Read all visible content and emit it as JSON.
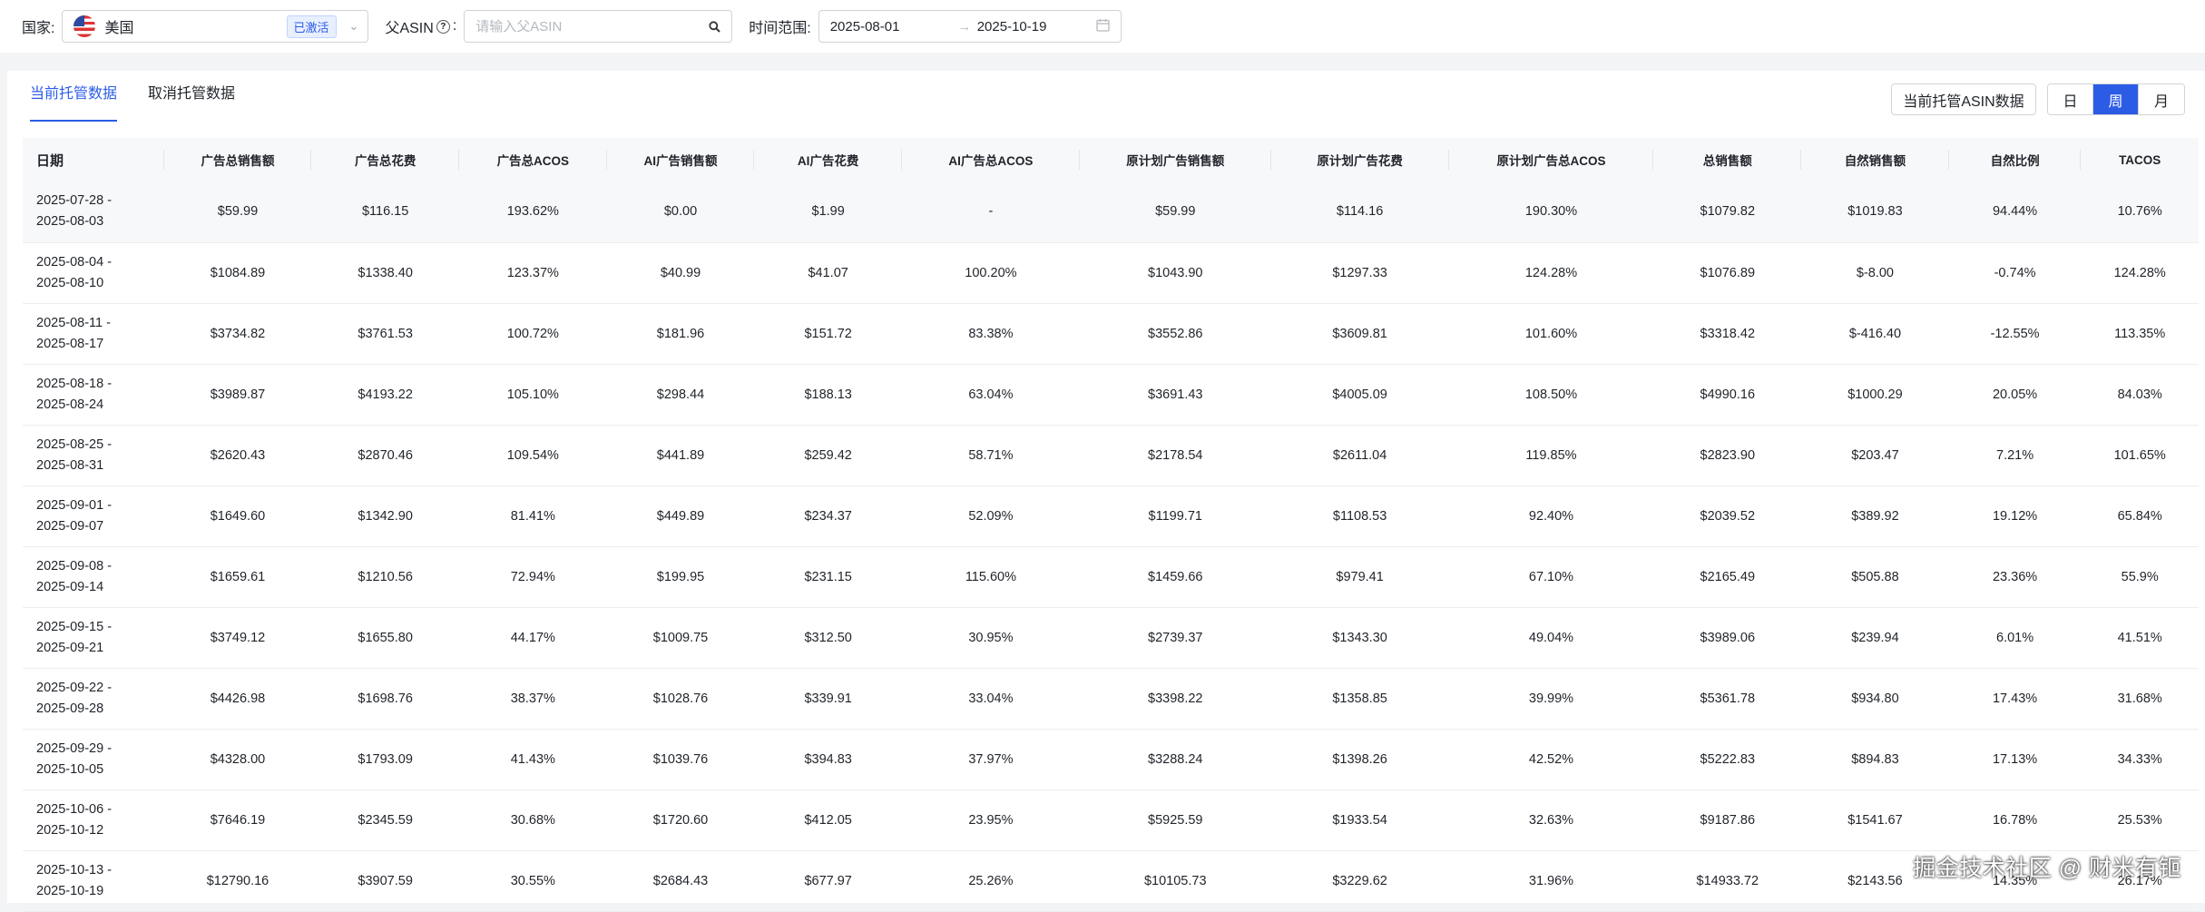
{
  "filters": {
    "country_label": "国家:",
    "country_value": "美国",
    "country_flag": "us-flag-icon",
    "country_badge": "已激活",
    "asin_label": "父ASIN",
    "asin_colon": ":",
    "asin_placeholder": "请输入父ASIN",
    "date_label": "时间范围:",
    "date_start": "2025-08-01",
    "date_separator": "→",
    "date_end": "2025-10-19"
  },
  "tabs": [
    {
      "label": "当前托管数据",
      "active": true
    },
    {
      "label": "取消托管数据",
      "active": false
    }
  ],
  "toolbar": {
    "export_label": "当前托管ASIN数据",
    "periods": [
      {
        "label": "日",
        "active": false
      },
      {
        "label": "周",
        "active": true
      },
      {
        "label": "月",
        "active": false
      }
    ]
  },
  "colors": {
    "accent": "#2c5ce6"
  },
  "table": {
    "columns": [
      "日期",
      "广告总销售额",
      "广告总花费",
      "广告总ACOS",
      "AI广告销售额",
      "AI广告花费",
      "AI广告总ACOS",
      "原计划广告销售额",
      "原计划广告花费",
      "原计划广告总ACOS",
      "总销售额",
      "自然销售额",
      "自然比例",
      "TACOS"
    ],
    "rows": [
      [
        "2025-07-28 - 2025-08-03",
        "$59.99",
        "$116.15",
        "193.62%",
        "$0.00",
        "$1.99",
        "-",
        "$59.99",
        "$114.16",
        "190.30%",
        "$1079.82",
        "$1019.83",
        "94.44%",
        "10.76%"
      ],
      [
        "2025-08-04 - 2025-08-10",
        "$1084.89",
        "$1338.40",
        "123.37%",
        "$40.99",
        "$41.07",
        "100.20%",
        "$1043.90",
        "$1297.33",
        "124.28%",
        "$1076.89",
        "$-8.00",
        "-0.74%",
        "124.28%"
      ],
      [
        "2025-08-11 - 2025-08-17",
        "$3734.82",
        "$3761.53",
        "100.72%",
        "$181.96",
        "$151.72",
        "83.38%",
        "$3552.86",
        "$3609.81",
        "101.60%",
        "$3318.42",
        "$-416.40",
        "-12.55%",
        "113.35%"
      ],
      [
        "2025-08-18 - 2025-08-24",
        "$3989.87",
        "$4193.22",
        "105.10%",
        "$298.44",
        "$188.13",
        "63.04%",
        "$3691.43",
        "$4005.09",
        "108.50%",
        "$4990.16",
        "$1000.29",
        "20.05%",
        "84.03%"
      ],
      [
        "2025-08-25 - 2025-08-31",
        "$2620.43",
        "$2870.46",
        "109.54%",
        "$441.89",
        "$259.42",
        "58.71%",
        "$2178.54",
        "$2611.04",
        "119.85%",
        "$2823.90",
        "$203.47",
        "7.21%",
        "101.65%"
      ],
      [
        "2025-09-01 - 2025-09-07",
        "$1649.60",
        "$1342.90",
        "81.41%",
        "$449.89",
        "$234.37",
        "52.09%",
        "$1199.71",
        "$1108.53",
        "92.40%",
        "$2039.52",
        "$389.92",
        "19.12%",
        "65.84%"
      ],
      [
        "2025-09-08 - 2025-09-14",
        "$1659.61",
        "$1210.56",
        "72.94%",
        "$199.95",
        "$231.15",
        "115.60%",
        "$1459.66",
        "$979.41",
        "67.10%",
        "$2165.49",
        "$505.88",
        "23.36%",
        "55.9%"
      ],
      [
        "2025-09-15 - 2025-09-21",
        "$3749.12",
        "$1655.80",
        "44.17%",
        "$1009.75",
        "$312.50",
        "30.95%",
        "$2739.37",
        "$1343.30",
        "49.04%",
        "$3989.06",
        "$239.94",
        "6.01%",
        "41.51%"
      ],
      [
        "2025-09-22 - 2025-09-28",
        "$4426.98",
        "$1698.76",
        "38.37%",
        "$1028.76",
        "$339.91",
        "33.04%",
        "$3398.22",
        "$1358.85",
        "39.99%",
        "$5361.78",
        "$934.80",
        "17.43%",
        "31.68%"
      ],
      [
        "2025-09-29 - 2025-10-05",
        "$4328.00",
        "$1793.09",
        "41.43%",
        "$1039.76",
        "$394.83",
        "37.97%",
        "$3288.24",
        "$1398.26",
        "42.52%",
        "$5222.83",
        "$894.83",
        "17.13%",
        "34.33%"
      ],
      [
        "2025-10-06 - 2025-10-12",
        "$7646.19",
        "$2345.59",
        "30.68%",
        "$1720.60",
        "$412.05",
        "23.95%",
        "$5925.59",
        "$1933.54",
        "32.63%",
        "$9187.86",
        "$1541.67",
        "16.78%",
        "25.53%"
      ],
      [
        "2025-10-13 - 2025-10-19",
        "$12790.16",
        "$3907.59",
        "30.55%",
        "$2684.43",
        "$677.97",
        "25.26%",
        "$10105.73",
        "$3229.62",
        "31.96%",
        "$14933.72",
        "$2143.56",
        "14.35%",
        "26.17%"
      ]
    ]
  },
  "watermark": "掘金技术社区 @ 财米有钷"
}
